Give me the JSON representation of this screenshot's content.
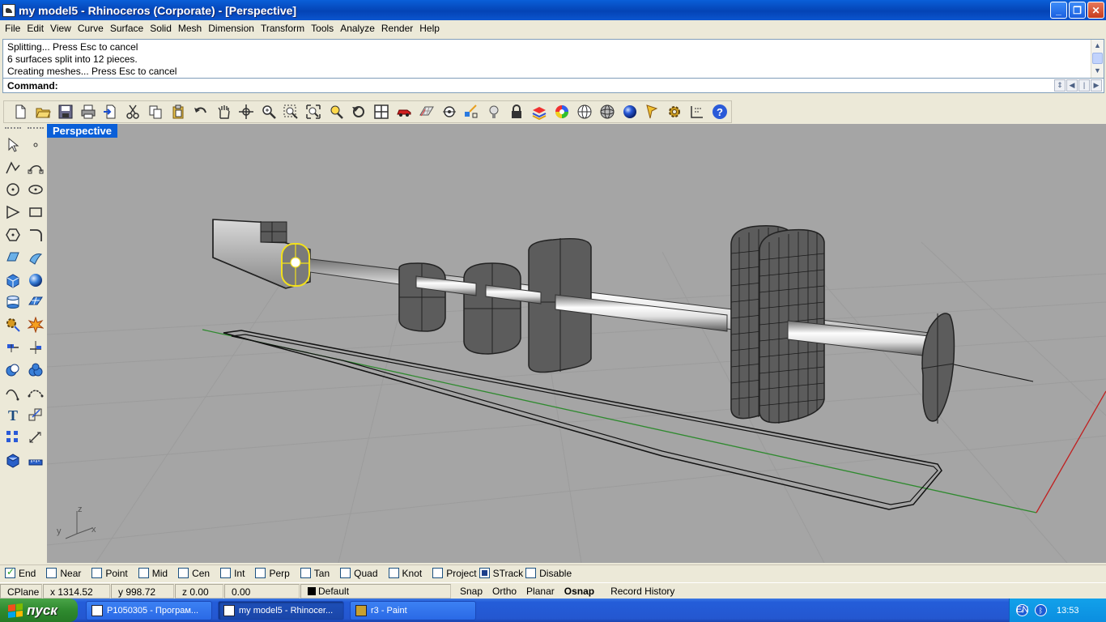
{
  "window": {
    "title": "my model5 - Rhinoceros (Corporate) - [Perspective]",
    "buttons": {
      "minimize": "_",
      "restore": "❐",
      "close": "✕"
    }
  },
  "menu": [
    "File",
    "Edit",
    "View",
    "Curve",
    "Surface",
    "Solid",
    "Mesh",
    "Dimension",
    "Transform",
    "Tools",
    "Analyze",
    "Render",
    "Help"
  ],
  "history": [
    "Splitting... Press Esc to cancel",
    "6 surfaces split into 12 pieces.",
    "Creating meshes... Press Esc to cancel"
  ],
  "command": {
    "label": "Command:",
    "value": ""
  },
  "toolbar": {
    "icons": [
      "new-icon",
      "open-icon",
      "save-icon",
      "print-icon",
      "import-icon",
      "cut-icon",
      "copy-icon",
      "paste-icon",
      "undo-icon",
      "pan-icon",
      "rotate-view-icon",
      "zoom-dynamic-icon",
      "zoom-window-icon",
      "zoom-extents-icon",
      "zoom-selected-icon",
      "undo-view-icon",
      "four-viewports-icon",
      "car-icon",
      "grid-icon",
      "cplane-icon",
      "osnap-icon",
      "light-icon",
      "lock-icon",
      "layer-icon",
      "color-icon",
      "wireframe-icon",
      "shaded-icon",
      "render-sphere-icon",
      "properties-icon",
      "settings-gear-icon",
      "dimension-icon",
      "help-icon"
    ]
  },
  "lefttools": {
    "col1": [
      "select-arrow-icon",
      "polyline-icon",
      "circle-icon",
      "curve-point-icon",
      "polygon-icon",
      "surface-icon",
      "box-solid-icon",
      "cylinder-icon",
      "gear-transform-icon",
      "edit-icon",
      "boolean-icon",
      "curve-edit-icon",
      "text-icon",
      "array-icon",
      "render-box-icon"
    ],
    "col2": [
      "point-icon",
      "arc-icon",
      "ellipse-icon",
      "rectangle-icon",
      "fillet-curve-icon",
      "sweep-icon",
      "sphere-icon",
      "plane-surface-icon",
      "explode-icon",
      "trim-icon",
      "boolean-union-icon",
      "blend-icon",
      "scale-icon",
      "dimension-tool-icon",
      "measure-icon"
    ]
  },
  "viewport": {
    "title": "Perspective",
    "axis": {
      "x": "x",
      "y": "y",
      "z": "z"
    }
  },
  "osnaps": [
    {
      "label": "End",
      "state": "checked"
    },
    {
      "label": "Near",
      "state": "unchecked"
    },
    {
      "label": "Point",
      "state": "unchecked"
    },
    {
      "label": "Mid",
      "state": "unchecked"
    },
    {
      "label": "Cen",
      "state": "unchecked"
    },
    {
      "label": "Int",
      "state": "unchecked"
    },
    {
      "label": "Perp",
      "state": "unchecked"
    },
    {
      "label": "Tan",
      "state": "unchecked"
    },
    {
      "label": "Quad",
      "state": "unchecked"
    },
    {
      "label": "Knot",
      "state": "unchecked"
    },
    {
      "label": "Project",
      "state": "unchecked"
    },
    {
      "label": "STrack",
      "state": "filled"
    },
    {
      "label": "Disable",
      "state": "unchecked"
    }
  ],
  "status": {
    "cplane": "CPlane",
    "x": "x 1314.52",
    "y": "y 998.72",
    "z": "z 0.00",
    "d": "0.00",
    "layer": "Default",
    "snap": "Snap",
    "ortho": "Ortho",
    "planar": "Planar",
    "osnap": "Osnap",
    "record_history": "Record History"
  },
  "taskbar": {
    "start": "пуск",
    "tasks": [
      "P1050305 - Програм...",
      "my model5 - Rhinocer...",
      "r3 - Paint"
    ],
    "lang": "EN",
    "clock": "13:53"
  }
}
